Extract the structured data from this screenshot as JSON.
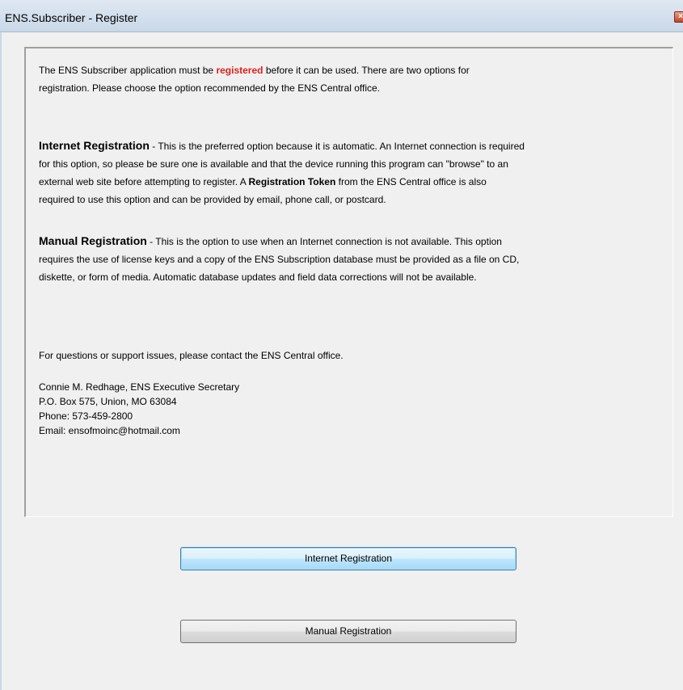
{
  "window": {
    "title": "ENS.Subscriber - Register",
    "close_glyph": "×"
  },
  "intro": {
    "line1_pre": "The ENS Subscriber application must be ",
    "line1_emph": "registered",
    "line1_post": " before it can be used.  There are two options for",
    "line2": "registration.  Please choose the option recommended by the ENS Central office."
  },
  "internet": {
    "heading": "Internet Registration",
    "line1_rest": " - This is the preferred option because it is automatic.  An Internet connection is required",
    "line2": "for this option, so please be sure one is available and that the device running this program can \"browse\" to an",
    "line3_pre": "external web site before attempting to register.  A ",
    "line3_strong": "Registration Token",
    "line3_post": " from the ENS Central office is also",
    "line4": "required to use this option and can be provided by email, phone call, or postcard."
  },
  "manual": {
    "heading": "Manual Registration",
    "line1_rest": " - This is the option to use when an Internet connection is not available.  This option",
    "line2": "requires the use of license keys and a copy of the ENS Subscription database must be provided as a file on CD,",
    "line3": "diskette, or form of media.  Automatic database updates and field data corrections will not be available."
  },
  "support": {
    "text": "For questions or support issues, please contact the ENS Central office."
  },
  "contact": {
    "name": "Connie M. Redhage, ENS Executive Secretary",
    "address": "P.O. Box 575, Union, MO  63084",
    "phone": "Phone: 573-459-2800",
    "email": "Email: ensofmoinc@hotmail.com"
  },
  "buttons": {
    "internet_label": "Internet Registration",
    "manual_label": "Manual Registration"
  },
  "colors": {
    "emphasis": "#e0201a"
  }
}
